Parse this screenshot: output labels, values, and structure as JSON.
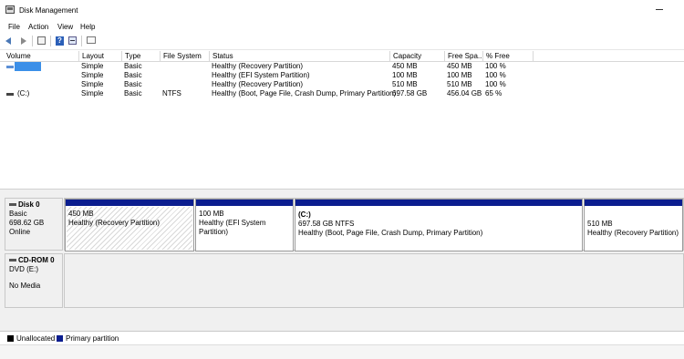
{
  "window": {
    "title": "Disk Management"
  },
  "menu": [
    "File",
    "Action",
    "View",
    "Help"
  ],
  "toolbar": {
    "help_glyph": "?"
  },
  "columns": [
    "Volume",
    "Layout",
    "Type",
    "File System",
    "Status",
    "Capacity",
    "Free Spa...",
    "% Free"
  ],
  "volumes": [
    {
      "volume": "",
      "layout": "Simple",
      "type": "Basic",
      "fs": "",
      "status": "Healthy (Recovery Partition)",
      "capacity": "450 MB",
      "free": "450 MB",
      "pct": "100 %",
      "icon": "volume-icon"
    },
    {
      "volume": "",
      "layout": "Simple",
      "type": "Basic",
      "fs": "",
      "status": "Healthy (EFI System Partition)",
      "capacity": "100 MB",
      "free": "100 MB",
      "pct": "100 %",
      "icon": "volume-icon"
    },
    {
      "volume": "",
      "layout": "Simple",
      "type": "Basic",
      "fs": "",
      "status": "Healthy (Recovery Partition)",
      "capacity": "510 MB",
      "free": "510 MB",
      "pct": "100 %",
      "icon": "volume-icon"
    },
    {
      "volume": "(C:)",
      "layout": "Simple",
      "type": "Basic",
      "fs": "NTFS",
      "status": "Healthy (Boot, Page File, Crash Dump, Primary Partition)",
      "capacity": "697.58 GB",
      "free": "456.04 GB",
      "pct": "65 %",
      "icon": "volume-icon"
    }
  ],
  "disk0": {
    "name": "Disk 0",
    "type": "Basic",
    "size": "698.62 GB",
    "state": "Online",
    "partitions": [
      {
        "label": "",
        "size": "450 MB",
        "status": "Healthy (Recovery Partition)"
      },
      {
        "label": "",
        "size": "100 MB",
        "status": "Healthy (EFI System Partition)"
      },
      {
        "label": "(C:)",
        "size": "697.58 GB NTFS",
        "status": "Healthy (Boot, Page File, Crash Dump, Primary Partition)"
      },
      {
        "label": "",
        "size": "510 MB",
        "status": "Healthy (Recovery Partition)"
      }
    ]
  },
  "cdrom": {
    "name": "CD-ROM 0",
    "type": "DVD (E:)",
    "state": "No Media"
  },
  "legend": [
    {
      "label": "Unallocated",
      "color": "#000000"
    },
    {
      "label": "Primary partition",
      "color": "#0b1d8f"
    }
  ]
}
